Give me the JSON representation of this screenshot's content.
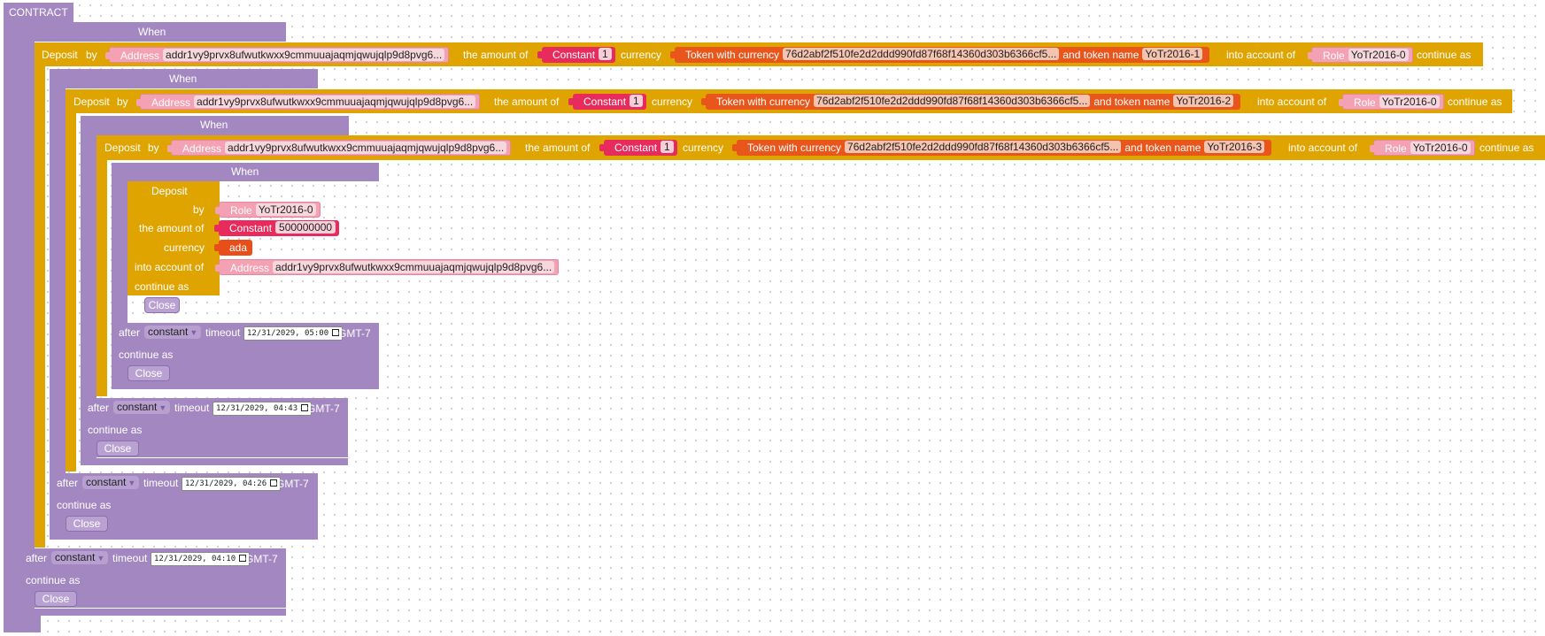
{
  "contract": {
    "label": "CONTRACT"
  },
  "labels": {
    "when": "When",
    "deposit": "Deposit",
    "by": "by",
    "amount_of": "the amount of",
    "currency": "currency",
    "into_account": "into account of",
    "continue_as": "continue as",
    "after": "after",
    "timeout": "timeout",
    "timezone": "GMT-7",
    "close": "Close",
    "address": "Address",
    "role": "Role",
    "constant": "Constant",
    "token_with_currency": "Token with currency",
    "and_token_name": "and token name",
    "timeout_type": "constant"
  },
  "address": "addr1vy9prvx8ufwutkwxx9cmmuuajaqmjqwujqlp9d8pvg6...",
  "currency_symbol": "76d2abf2f510fe2d2ddd990fd87f68f14360d303b6366cf5...",
  "deposits": [
    {
      "amount": "1",
      "token_name": "YoTr2016-1",
      "role": "YoTr2016-0"
    },
    {
      "amount": "1",
      "token_name": "YoTr2016-2",
      "role": "YoTr2016-0"
    },
    {
      "amount": "1",
      "token_name": "YoTr2016-3",
      "role": "YoTr2016-0"
    }
  ],
  "inner_deposit": {
    "role": "YoTr2016-0",
    "amount": "500000000",
    "currency": "ada"
  },
  "timeouts": [
    "12/31/2029, 05:00",
    "12/31/2029, 04:43",
    "12/31/2029, 04:26",
    "12/31/2029, 04:10"
  ],
  "colors": {
    "when": "#a287c0",
    "deposit": "#e0a400",
    "address": "#f3a1b3",
    "constant": "#e82b5d",
    "token": "#e8561c"
  }
}
